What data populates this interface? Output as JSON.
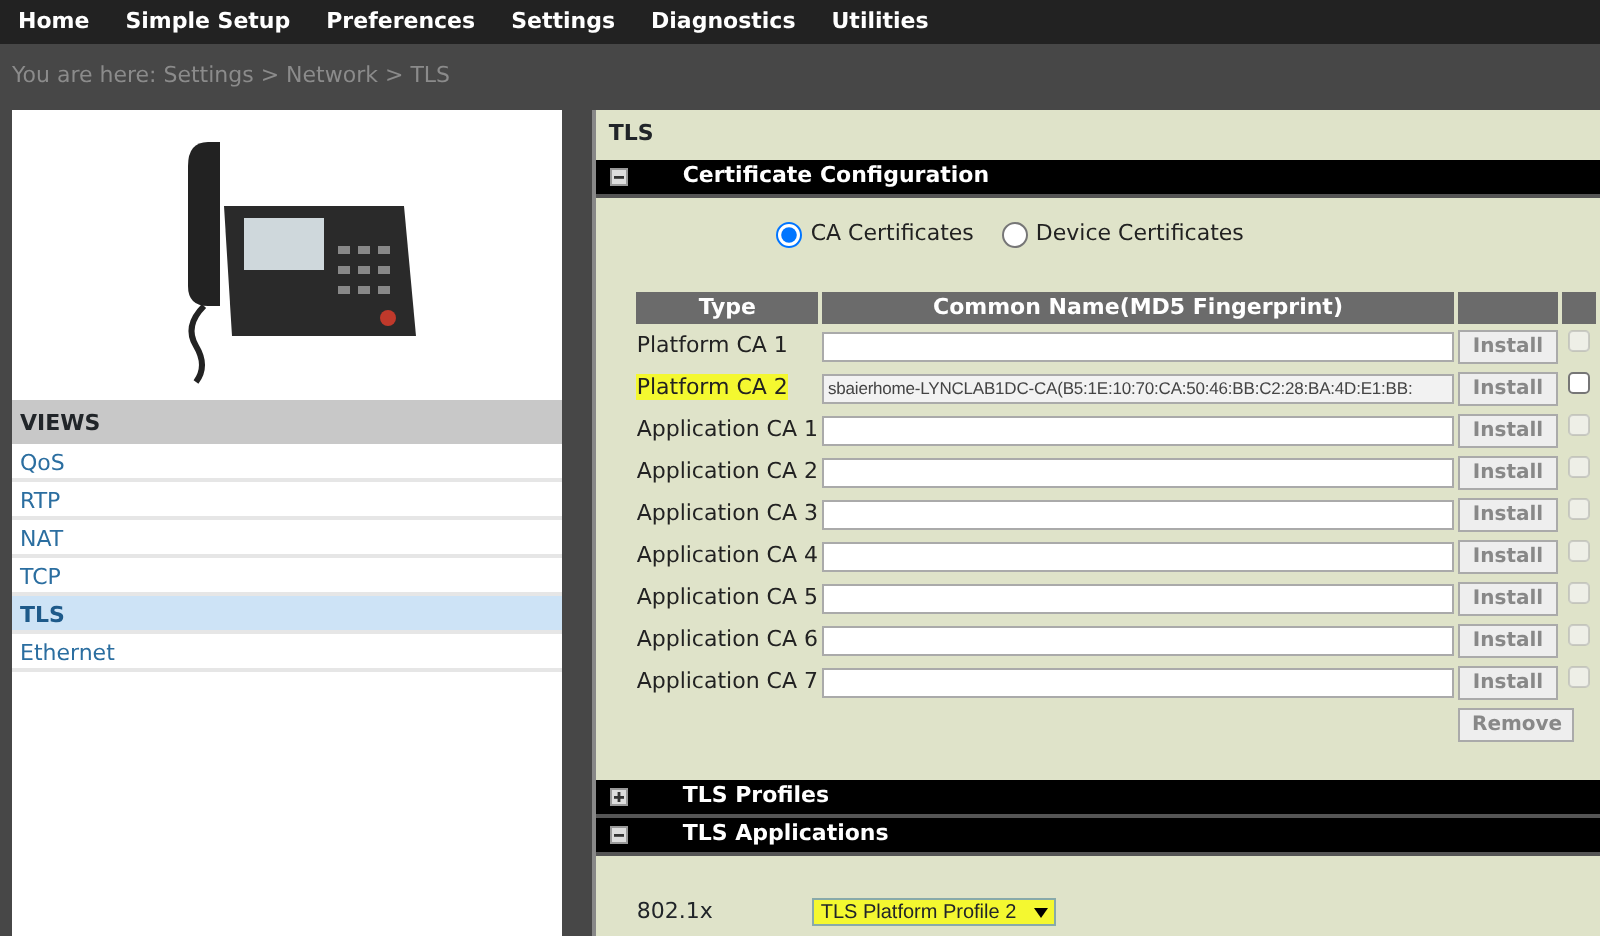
{
  "menu": [
    {
      "label": "Home"
    },
    {
      "label": "Simple Setup"
    },
    {
      "label": "Preferences"
    },
    {
      "label": "Settings"
    },
    {
      "label": "Diagnostics"
    },
    {
      "label": "Utilities"
    }
  ],
  "breadcrumb": "You are here: Settings > Network > TLS",
  "sidebar": {
    "heading": "VIEWS",
    "items": [
      {
        "label": "QoS",
        "selected": false
      },
      {
        "label": "RTP",
        "selected": false
      },
      {
        "label": "NAT",
        "selected": false
      },
      {
        "label": "TCP",
        "selected": false
      },
      {
        "label": "TLS",
        "selected": true
      },
      {
        "label": "Ethernet",
        "selected": false
      }
    ]
  },
  "panel": {
    "title": "TLS",
    "sections": [
      {
        "title": "Certificate Configuration",
        "expanded": true,
        "kind": "certificates"
      },
      {
        "title": "TLS Profiles",
        "expanded": false
      },
      {
        "title": "TLS Applications",
        "expanded": true,
        "kind": "applications"
      }
    ]
  },
  "certificates": {
    "radios": [
      {
        "label": "CA Certificates",
        "selected": true
      },
      {
        "label": "Device Certificates",
        "selected": false
      }
    ],
    "columns": [
      "Type",
      "Common Name(MD5 Fingerprint)"
    ],
    "rows": [
      {
        "type": "Platform CA 1",
        "value": "",
        "button": "Install",
        "checked": false,
        "disabled": true,
        "highlighted": false
      },
      {
        "type": "Platform CA 2",
        "value": "sbaierhome-LYNCLAB1DC-CA(B5:1E:10:70:CA:50:46:BB:C2:28:BA:4D:E1:BB:",
        "button": "Install",
        "checked": false,
        "disabled": false,
        "highlighted": true
      },
      {
        "type": "Application CA 1",
        "value": "",
        "button": "Install",
        "checked": false,
        "disabled": true,
        "highlighted": false
      },
      {
        "type": "Application CA 2",
        "value": "",
        "button": "Install",
        "checked": false,
        "disabled": true,
        "highlighted": false
      },
      {
        "type": "Application CA 3",
        "value": "",
        "button": "Install",
        "checked": false,
        "disabled": true,
        "highlighted": false
      },
      {
        "type": "Application CA 4",
        "value": "",
        "button": "Install",
        "checked": false,
        "disabled": true,
        "highlighted": false
      },
      {
        "type": "Application CA 5",
        "value": "",
        "button": "Install",
        "checked": false,
        "disabled": true,
        "highlighted": false
      },
      {
        "type": "Application CA 6",
        "value": "",
        "button": "Install",
        "checked": false,
        "disabled": true,
        "highlighted": false
      },
      {
        "type": "Application CA 7",
        "value": "",
        "button": "Install",
        "checked": false,
        "disabled": true,
        "highlighted": false
      }
    ],
    "remove_button": "Remove"
  },
  "applications": [
    {
      "label": "802.1x",
      "value": "TLS Platform Profile 2",
      "highlighted": true
    }
  ]
}
